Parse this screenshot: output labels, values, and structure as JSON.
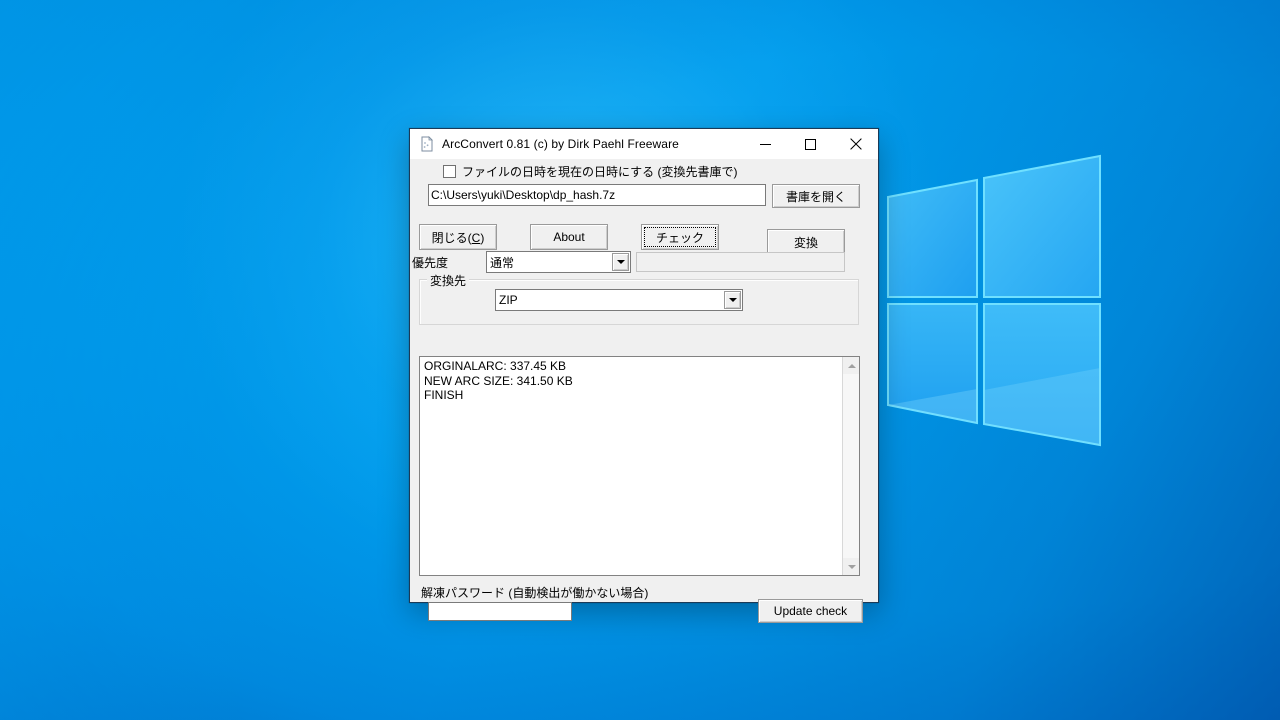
{
  "desktop": {
    "wallpaper_name": "windows-10-hero-logo",
    "background_color": "#00a2f0",
    "logo_color": "#3fb9f5"
  },
  "window": {
    "title": "ArcConvert 0.81 (c) by Dirk Paehl Freeware",
    "icon": "document-icon",
    "controls": {
      "minimize": "minimize-icon",
      "maximize": "maximize-icon",
      "close": "close-icon"
    }
  },
  "form": {
    "date_checkbox": {
      "label": "ファイルの日時を現在の日時にする (変換先書庫で)",
      "checked": false
    },
    "archive_path": {
      "value": "C:\\Users\\yuki\\Desktop\\dp_hash.7z",
      "placeholder": ""
    },
    "open_archive_button": "書庫を開く",
    "buttons": {
      "close": "閉じる(C)",
      "close_mnemonic": "C",
      "about": "About",
      "check": "チェック",
      "convert": "変換"
    },
    "priority": {
      "label": "優先度",
      "value": "通常",
      "options": [
        "通常"
      ]
    },
    "progress_field": {
      "value": "",
      "enabled": false
    },
    "target_group": {
      "title": "変換先",
      "format": {
        "value": "ZIP",
        "options": [
          "ZIP"
        ]
      }
    },
    "log": {
      "lines": [
        "ORGINALARC: 337.45 KB",
        "NEW ARC SIZE: 341.50 KB",
        "FINISH"
      ]
    },
    "password": {
      "label": "解凍パスワード (自動検出が働かない場合)",
      "value": "",
      "placeholder": ""
    },
    "update_check_button": "Update check"
  }
}
